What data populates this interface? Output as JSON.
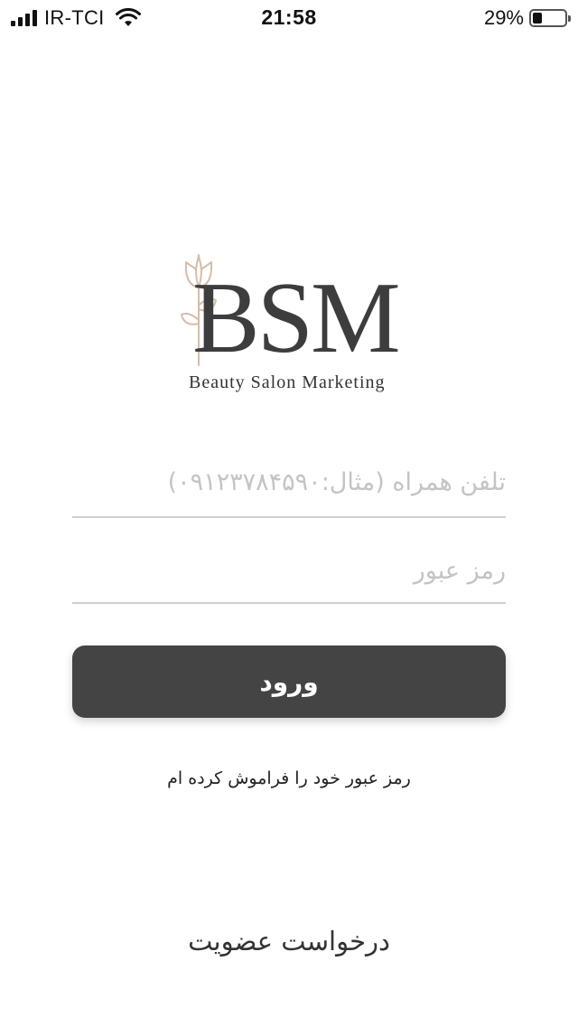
{
  "status_bar": {
    "carrier": "IR-TCI",
    "time": "21:58",
    "battery_percent_label": "29%",
    "battery_level": 0.29
  },
  "logo": {
    "letters": "BSM",
    "tagline": "Beauty Salon Marketing",
    "accent_color": "#d8bca8",
    "text_color": "#3d3d3d"
  },
  "form": {
    "phone_placeholder": "تلفن همراه (مثال:۰۹۱۲۳۷۸۴۵۹۰)",
    "phone_value": "",
    "password_placeholder": "رمز عبور",
    "password_value": "",
    "login_label": "ورود",
    "forgot_label": "رمز عبور خود را فراموش کرده ام",
    "signup_label": "درخواست عضویت"
  },
  "colors": {
    "button_bg": "#444444",
    "divider": "#cfcfcf",
    "placeholder": "#c4c4c4"
  }
}
